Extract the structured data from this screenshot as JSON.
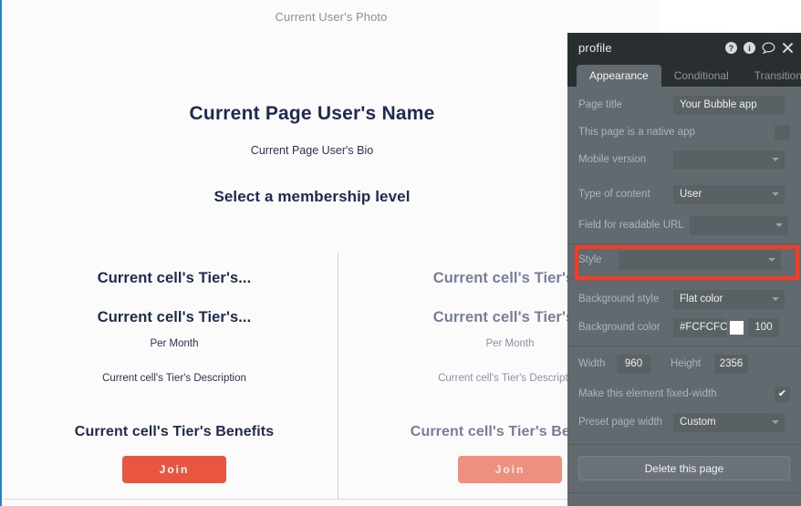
{
  "canvas": {
    "photo_placeholder": "Current User's Photo",
    "user_name": "Current Page User's Name",
    "user_bio": "Current Page User's Bio",
    "section_heading": "Select a membership level",
    "tiers": [
      {
        "title": "Current cell's Tier's...",
        "price": "Current cell's Tier's...",
        "period": "Per Month",
        "description": "Current cell's Tier's Description",
        "benefits": "Current cell's Tier's Benefits",
        "join_label": "Join"
      },
      {
        "title": "Current cell's Tier's...",
        "price": "Current cell's Tier's...",
        "period": "Per Month",
        "description": "Current cell's Tier's Description",
        "benefits": "Current cell's Tier's Benefits",
        "join_label": "Join"
      }
    ]
  },
  "panel": {
    "title": "profile",
    "header_icons": [
      "help-circle-icon",
      "info-circle-icon",
      "comment-icon",
      "close-icon"
    ],
    "tabs": [
      {
        "label": "Appearance",
        "active": true
      },
      {
        "label": "Conditional",
        "active": false
      },
      {
        "label": "Transitions",
        "active": false
      }
    ],
    "fields": {
      "page_title_label": "Page title",
      "page_title_value": "Your Bubble app",
      "native_app_label": "This page is a native app",
      "native_app_checked": "",
      "mobile_version_label": "Mobile version",
      "mobile_version_value": "",
      "type_of_content_label": "Type of content",
      "type_of_content_value": "User",
      "readable_url_label": "Field for readable URL",
      "readable_url_value": "",
      "style_label": "Style",
      "style_value": "",
      "background_style_label": "Background style",
      "background_style_value": "Flat color",
      "background_color_label": "Background color",
      "background_color_hex": "#FCFCFC",
      "background_color_swatch": "#FCFCFC",
      "background_color_opacity": "100",
      "width_label": "Width",
      "width_value": "960",
      "height_label": "Height",
      "height_value": "2356",
      "fixed_width_label": "Make this element fixed-width",
      "fixed_width_checked": "✔",
      "preset_width_label": "Preset page width",
      "preset_width_value": "Custom"
    },
    "delete_label": "Delete this page",
    "highlight_color": "#FB3B21"
  }
}
